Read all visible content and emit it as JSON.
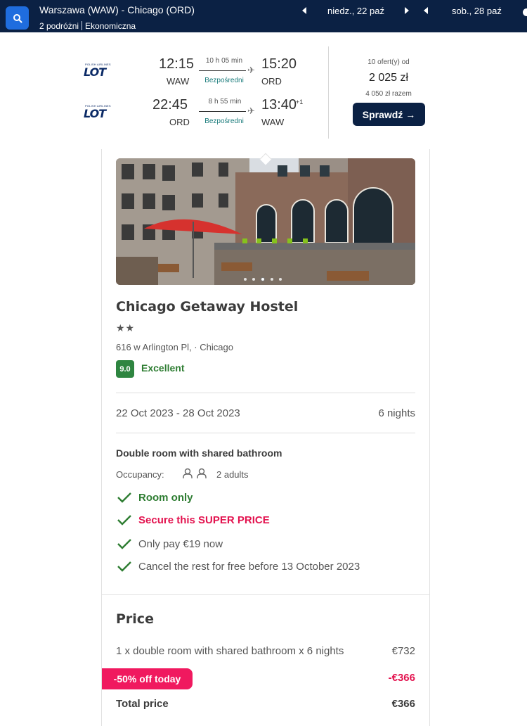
{
  "topbar": {
    "route": "Warszawa (WAW) - Chicago (ORD)",
    "passengers": "2 podróżni",
    "cabin": "Ekonomiczna",
    "outbound_date": "niedz., 22 paź",
    "return_date": "sob., 28 paź",
    "search_icon": "search-icon",
    "background": "#0b2144"
  },
  "flight": {
    "airline_logo": "LOT",
    "airline_tagline": "POLISH AIRLINES",
    "outbound": {
      "depart_time": "12:15",
      "depart_airport": "WAW",
      "duration": "10 h 05 min",
      "stops": "Bezpośredni",
      "arrive_time": "15:20",
      "arrive_airport": "ORD",
      "day_offset": ""
    },
    "return": {
      "depart_time": "22:45",
      "depart_airport": "ORD",
      "duration": "8 h 55 min",
      "stops": "Bezpośredni",
      "arrive_time": "13:40",
      "arrive_airport": "WAW",
      "day_offset": "+1"
    },
    "offers_count": "10 ofert(y) od",
    "price": "2 025 zł",
    "price_total": "4 050 zł razem",
    "check_button": "Sprawdź →"
  },
  "hotel": {
    "name": "Chicago Getaway Hostel",
    "stars": "★★",
    "address": "616 w Arlington Pl, · Chicago",
    "score": "9.0",
    "score_label": "Excellent",
    "dates": "22 Oct 2023 - 28 Oct 2023",
    "nights": "6 nights",
    "room_type": "Double room with shared bathroom",
    "occupancy_label": "Occupancy:",
    "occupancy_value": "2 adults",
    "features": [
      {
        "text": "Room only",
        "style": "green"
      },
      {
        "text": "Secure this SUPER PRICE",
        "style": "pink"
      },
      {
        "text": "Only pay €19 now",
        "style": "grey"
      },
      {
        "text": "Cancel the rest for free before 13 October 2023",
        "style": "grey"
      }
    ],
    "photo_dots": 5,
    "photo_active_dot": 3
  },
  "price": {
    "title": "Price",
    "line_item": "1 x double room with shared bathroom x 6 nights",
    "line_amount": "€732",
    "promo_badge": "-50% off today",
    "promo_amount": "-€366",
    "total_label": "Total price",
    "total_amount": "€366"
  },
  "colors": {
    "accent_blue": "#1f6dde",
    "navy": "#0b2144",
    "green": "#2e7d32",
    "pink": "#f0195f"
  }
}
